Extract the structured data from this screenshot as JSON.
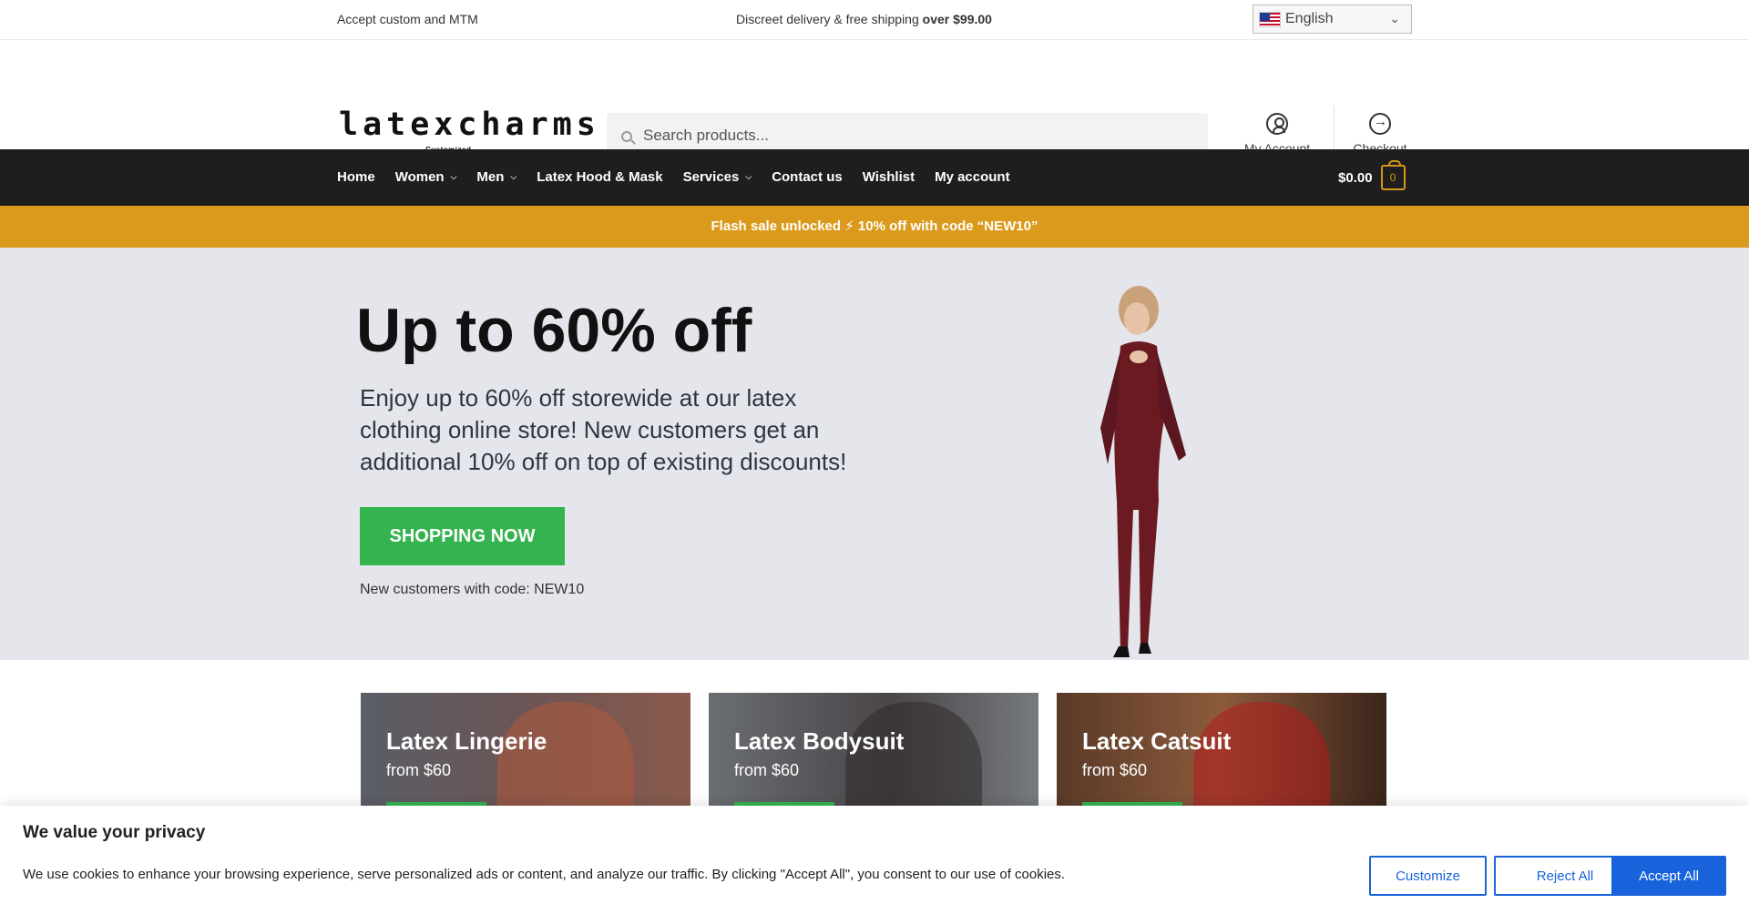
{
  "topbar": {
    "left_text": "Accept custom and MTM",
    "center_text": "Discreet delivery & free shipping ",
    "center_bold": "over $99.00",
    "language": "English"
  },
  "header": {
    "logo_text": "latexcharms",
    "logo_subtext": "Customized",
    "search_placeholder": "Search products...",
    "account_label": "My Account",
    "checkout_label": "Checkout"
  },
  "nav": {
    "items": [
      {
        "label": "Home",
        "dropdown": false
      },
      {
        "label": "Women",
        "dropdown": true
      },
      {
        "label": "Men",
        "dropdown": true
      },
      {
        "label": "Latex Hood & Mask",
        "dropdown": false
      },
      {
        "label": "Services",
        "dropdown": true
      },
      {
        "label": "Contact us",
        "dropdown": false
      },
      {
        "label": "Wishlist",
        "dropdown": false
      },
      {
        "label": "My account",
        "dropdown": false
      }
    ],
    "cart_amount": "$0.00",
    "cart_count": "0"
  },
  "flash": {
    "text": "Flash sale unlocked ⚡ 10% off with code “NEW10”"
  },
  "hero": {
    "title": "Up to 60% off",
    "description": "Enjoy up to 60% off storewide at our latex clothing online store! New customers get an additional 10% off on top of existing discounts!",
    "button": "SHOPPING NOW",
    "code_note": "New customers with code: NEW10"
  },
  "categories": [
    {
      "title": "Latex Lingerie",
      "price": "from $60"
    },
    {
      "title": "Latex Bodysuit",
      "price": "from $60"
    },
    {
      "title": "Latex Catsuit",
      "price": "from $60"
    }
  ],
  "cookie": {
    "title": "We value your privacy",
    "text": "We use cookies to enhance your browsing experience, serve personalized ads or content, and analyze our traffic. By clicking \"Accept All\", you consent to our use of cookies.",
    "customize": "Customize",
    "reject": "Reject All",
    "accept": "Accept All"
  },
  "colors": {
    "nav_bg": "#1e1e1e",
    "flash_bg": "#db9a1b",
    "hero_bg": "#e4e6ec",
    "cta_green": "#34b34e",
    "cookie_blue": "#1863dc"
  }
}
